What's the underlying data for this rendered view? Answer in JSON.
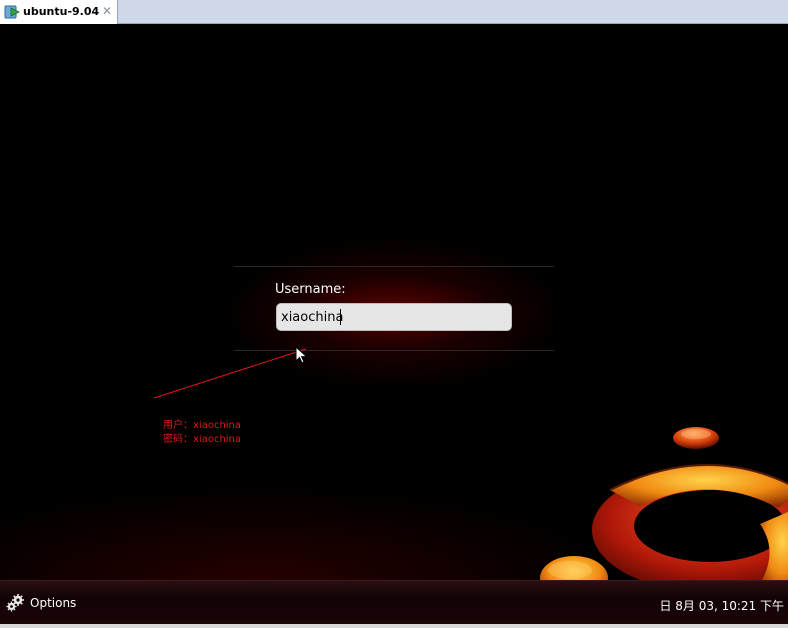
{
  "vm_tab": {
    "title": "ubuntu-9.04",
    "icon": "vm-power-icon",
    "close_glyph": "✕"
  },
  "login": {
    "username_label": "Username:",
    "username_value": "xiaochina"
  },
  "annotation": {
    "user_line": "用户：xiaochina",
    "password_line": "密码：xiaochina",
    "color": "#e01818"
  },
  "bottom_panel": {
    "options_label": "Options",
    "options_icon": "gear-icon",
    "clock": "日   8月 03, 10:21 下午"
  },
  "colors": {
    "accent": "#e01818",
    "logo_orange": "#f08a12",
    "logo_red": "#b01808",
    "background": "#000000"
  }
}
